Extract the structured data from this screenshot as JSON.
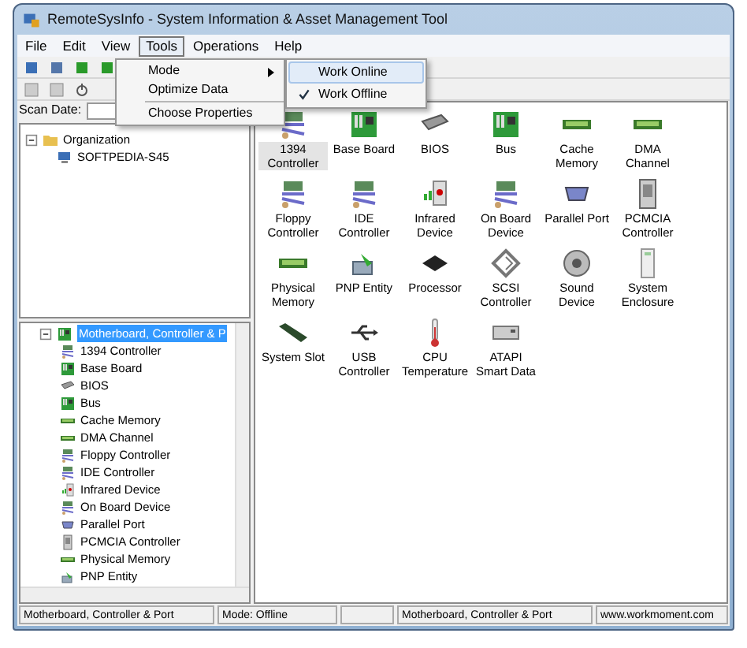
{
  "window": {
    "title": "RemoteSysInfo - System Information & Asset Management Tool"
  },
  "menu": [
    {
      "label": "File",
      "selected": false
    },
    {
      "label": "Edit",
      "selected": false
    },
    {
      "label": "View",
      "selected": false
    },
    {
      "label": "Tools",
      "selected": true
    },
    {
      "label": "Operations",
      "selected": false
    },
    {
      "label": "Help",
      "selected": false
    }
  ],
  "open_menu": {
    "items": [
      {
        "label": "Mode",
        "kind": "submenu"
      },
      {
        "label": "Optimize Data",
        "kind": "item"
      },
      {
        "label": "Choose Properties",
        "kind": "item"
      }
    ],
    "submenu": [
      {
        "label": "Work Online",
        "checked": false,
        "selected": true
      },
      {
        "label": "Work Offline",
        "checked": true,
        "selected": false
      }
    ]
  },
  "scan_date": {
    "label": "Scan Date:"
  },
  "org_tree": [
    {
      "label": "Organization",
      "expanded": true,
      "children": [
        {
          "label": "SOFTPEDIA-S45"
        }
      ]
    }
  ],
  "category_tree": {
    "label": "Motherboard, Controller & P",
    "selected": true,
    "expanded": true,
    "children": [
      {
        "label": "1394 Controller"
      },
      {
        "label": "Base Board"
      },
      {
        "label": "BIOS"
      },
      {
        "label": "Bus"
      },
      {
        "label": "Cache Memory"
      },
      {
        "label": "DMA Channel"
      },
      {
        "label": "Floppy Controller"
      },
      {
        "label": "IDE Controller"
      },
      {
        "label": "Infrared Device"
      },
      {
        "label": "On Board Device"
      },
      {
        "label": "Parallel Port"
      },
      {
        "label": "PCMCIA Controller"
      },
      {
        "label": "Physical Memory"
      },
      {
        "label": "PNP Entity"
      }
    ]
  },
  "devices": [
    {
      "label": "1394 Controller",
      "selected": true
    },
    {
      "label": "Base Board",
      "selected": false
    },
    {
      "label": "BIOS",
      "selected": false
    },
    {
      "label": "Bus",
      "selected": false
    },
    {
      "label": "Cache Memory",
      "selected": false
    },
    {
      "label": "DMA Channel",
      "selected": false
    },
    {
      "label": "Floppy Controller",
      "selected": false
    },
    {
      "label": "IDE Controller",
      "selected": false
    },
    {
      "label": "Infrared Device",
      "selected": false
    },
    {
      "label": "On Board Device",
      "selected": false
    },
    {
      "label": "Parallel Port",
      "selected": false
    },
    {
      "label": "PCMCIA Controller",
      "selected": false
    },
    {
      "label": "Physical Memory",
      "selected": false
    },
    {
      "label": "PNP Entity",
      "selected": false
    },
    {
      "label": "Processor",
      "selected": false
    },
    {
      "label": "SCSI Controller",
      "selected": false
    },
    {
      "label": "Sound Device",
      "selected": false
    },
    {
      "label": "System Enclosure",
      "selected": false
    },
    {
      "label": "System Slot",
      "selected": false
    },
    {
      "label": "USB Controller",
      "selected": false
    },
    {
      "label": "CPU Temperature",
      "selected": false
    },
    {
      "label": "ATAPI Smart Data",
      "selected": false
    }
  ],
  "status_bar": [
    "Motherboard, Controller & Port",
    "Mode: Offline",
    "Motherboard, Controller & Port",
    "www.workmoment.com"
  ]
}
